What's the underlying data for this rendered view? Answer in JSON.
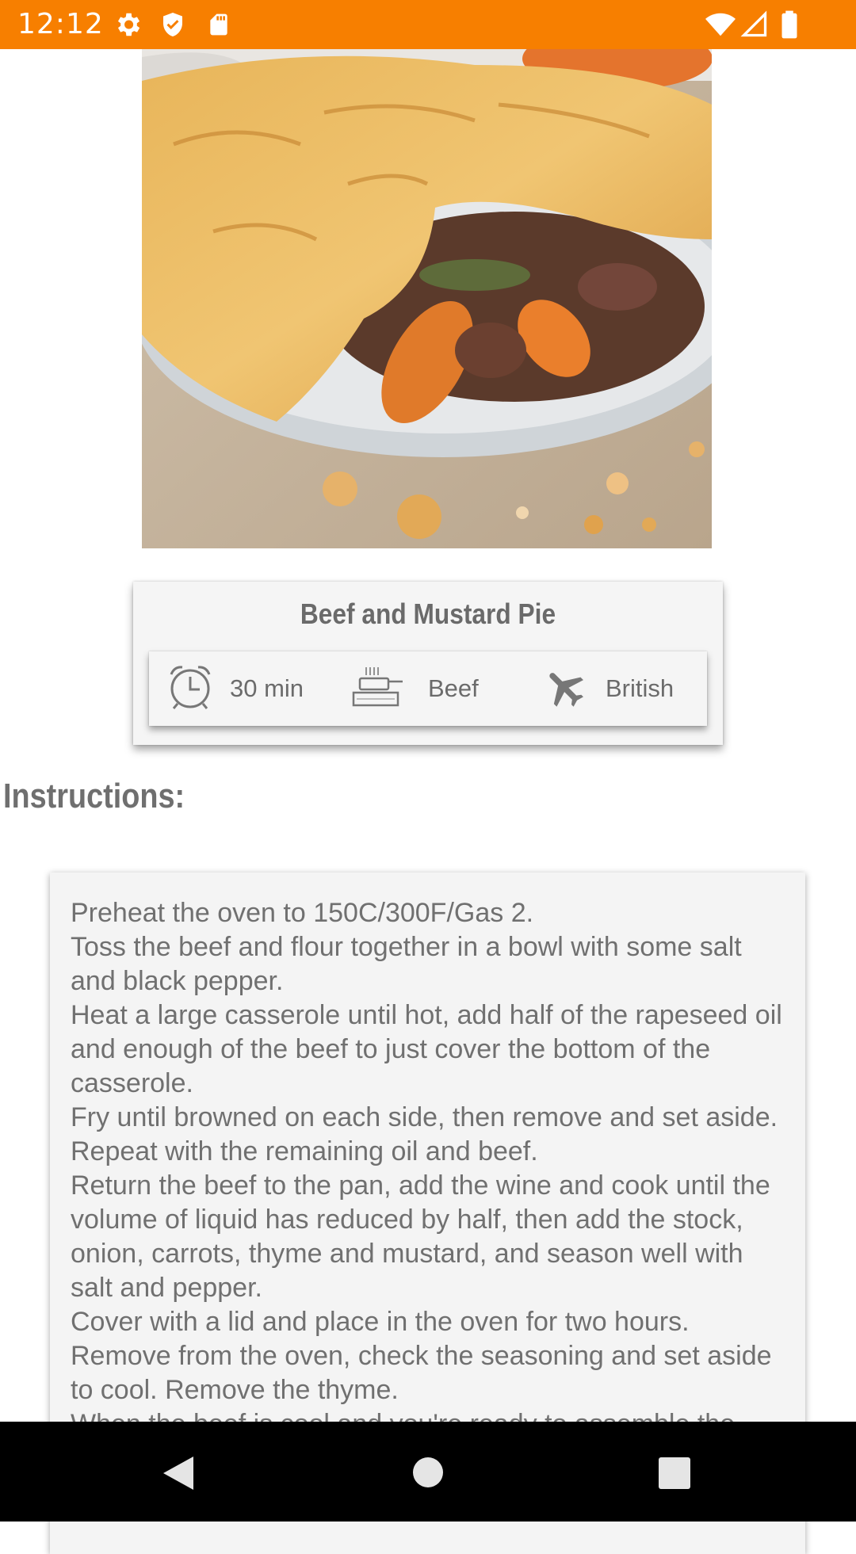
{
  "status_bar": {
    "time": "12:12",
    "icons": [
      "gear-icon",
      "shield-icon",
      "sd-card-icon",
      "wifi-icon",
      "signal-icon",
      "battery-icon"
    ],
    "background": "#f77f00"
  },
  "recipe": {
    "image_alt": "pie-photo",
    "title": "Beef and Mustard Pie",
    "time": "30 min",
    "category": "Beef",
    "area": "British"
  },
  "instructions": {
    "heading": "Instructions:",
    "text": "Preheat the oven to 150C/300F/Gas 2.\nToss the beef and flour together in a bowl with some salt and black pepper.\nHeat a large casserole until hot, add half of the rapeseed oil and enough of the beef to just cover the bottom of the casserole.\nFry until browned on each side, then remove and set aside. Repeat with the remaining oil and beef.\nReturn the beef to the pan, add the wine and cook until the volume of liquid has reduced by half, then add the stock, onion, carrots, thyme and mustard, and season well with salt and pepper.\nCover with a lid and place in the oven for two hours.\nRemove from the oven, check the seasoning and set aside to cool. Remove the thyme.\nWhen the beef is cool and you're ready to assemble the"
  },
  "nav_bar": {
    "buttons": [
      "back-icon",
      "home-icon",
      "recents-icon"
    ]
  }
}
